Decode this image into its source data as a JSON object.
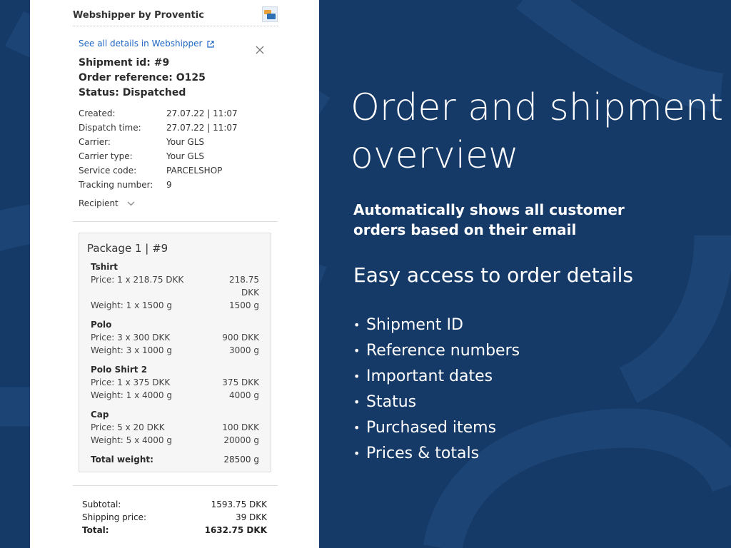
{
  "panel": {
    "app_title": "Webshipper by Proventic",
    "details_link": "See all details in Webshipper",
    "shipment_id": "Shipment id: #9",
    "order_reference": "Order reference: O125",
    "status": "Status: Dispatched",
    "info": [
      {
        "label": "Created:",
        "value": "27.07.22 | 11:07"
      },
      {
        "label": "Dispatch time:",
        "value": "27.07.22 | 11:07"
      },
      {
        "label": "Carrier:",
        "value": "Your GLS"
      },
      {
        "label": "Carrier type:",
        "value": "Your GLS"
      },
      {
        "label": "Service code:",
        "value": "PARCELSHOP"
      },
      {
        "label": "Tracking number:",
        "value": "9"
      }
    ],
    "recipient_label": "Recipient",
    "package": {
      "title": "Package 1 | #9",
      "items": [
        {
          "name": "Tshirt",
          "price_label": "Price: 1 x 218.75 DKK",
          "price_value": "218.75 DKK",
          "weight_label": "Weight: 1 x 1500 g",
          "weight_value": "1500 g"
        },
        {
          "name": "Polo",
          "price_label": "Price: 3 x 300 DKK",
          "price_value": "900 DKK",
          "weight_label": "Weight: 3 x 1000 g",
          "weight_value": "3000 g"
        },
        {
          "name": "Polo Shirt 2",
          "price_label": "Price: 1 x 375 DKK",
          "price_value": "375 DKK",
          "weight_label": "Weight: 1 x 4000 g",
          "weight_value": "4000 g"
        },
        {
          "name": "Cap",
          "price_label": "Price: 5 x 20 DKK",
          "price_value": "100 DKK",
          "weight_label": "Weight: 5 x 4000 g",
          "weight_value": "20000 g"
        }
      ],
      "total_weight_label": "Total weight:",
      "total_weight_value": "28500 g"
    },
    "summary": [
      {
        "label": "Subtotal:",
        "value": "1593.75 DKK"
      },
      {
        "label": "Shipping price:",
        "value": "39 DKK"
      },
      {
        "label": "Total:",
        "value": "1632.75 DKK"
      }
    ]
  },
  "promo": {
    "heading": "Order and shipment overview",
    "subheading_bold": "Automatically shows all customer orders based on their email",
    "subheading": "Easy access to order details",
    "bullets": [
      "Shipment ID",
      "Reference numbers",
      "Important dates",
      "Status",
      "Purchased items",
      "Prices & totals"
    ]
  },
  "colors": {
    "background": "#163a68",
    "link": "#1f66c3",
    "panel": "#ffffff"
  },
  "icons": {
    "external_link": "external-link-icon",
    "close": "close-icon",
    "chevron": "chevron-down-icon",
    "logo": "webshipper-logo-icon"
  }
}
